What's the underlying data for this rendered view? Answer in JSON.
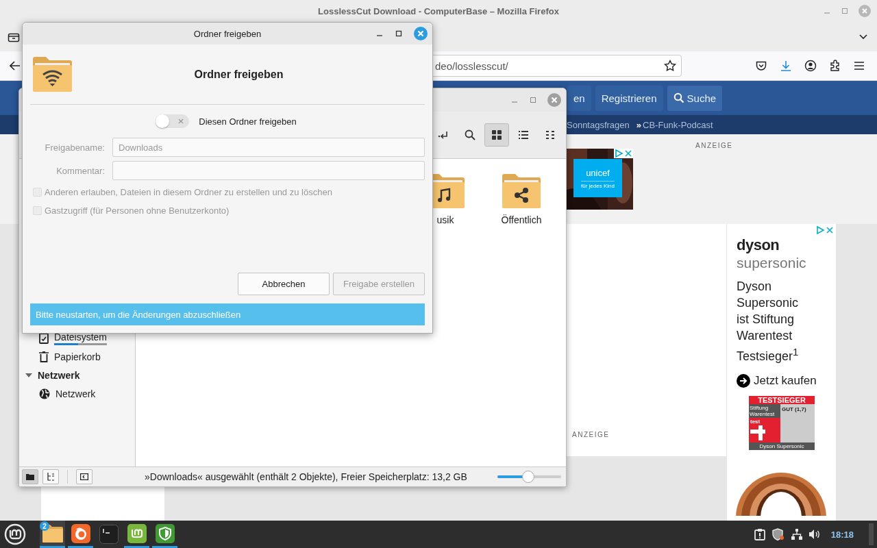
{
  "browser": {
    "title": "LosslessCut Download - ComputerBase – Mozilla Firefox",
    "url": "deo/losslesscut/"
  },
  "site": {
    "nav": [
      {
        "label": "en",
        "kind": "plain"
      },
      {
        "label": "Registrieren",
        "kind": "plain"
      },
      {
        "label": "Suche",
        "kind": "search"
      }
    ],
    "subnav": [
      {
        "label": "Sonntagsfragen",
        "marker_shown": false
      },
      {
        "label": "CB-Funk-Podcast",
        "marker": "»",
        "marker_shown": true
      }
    ],
    "ad_labels": [
      "ANZEIGE",
      "ANZEIGE"
    ]
  },
  "unicef_ad": {
    "logo": "unicef",
    "tagline": "für jedes Kind"
  },
  "dyson_ad": {
    "brand": "dyson",
    "product": "supersonic",
    "headline": "Dyson Supersonic ist Stiftung Warentest Testsieger$^{1}$",
    "cta": "Jetzt kaufen",
    "badge": {
      "title": "TESTSIEGER",
      "org": "Stiftung Warentest",
      "logo": "test",
      "grade": "GUT (1,7)",
      "footer": "Dyson Supersonic"
    }
  },
  "file_manager": {
    "toolbar": [
      {
        "kind": "return",
        "selected": false
      },
      {
        "kind": "search",
        "selected": false
      },
      {
        "kind": "grid",
        "selected": true
      },
      {
        "kind": "list",
        "selected": false
      },
      {
        "kind": "compact",
        "selected": false
      }
    ],
    "files": [
      {
        "name": "usik",
        "kind": "music"
      },
      {
        "name": "Öffentlich",
        "kind": "share"
      }
    ],
    "sidebar": {
      "items": [
        {
          "label": "Dateisystem",
          "kind": "drive",
          "level": 0.45
        },
        {
          "label": "Papierkorb",
          "kind": "trash"
        }
      ],
      "sections": [
        {
          "title": "Netzwerk",
          "expanded": true,
          "items": [
            {
              "label": "Netzwerk",
              "kind": "network"
            }
          ]
        }
      ]
    },
    "status_buttons": [
      {
        "kind": "places",
        "selected": true
      },
      {
        "kind": "tree",
        "selected": false
      },
      {
        "kind": "sidebar",
        "selected": false
      }
    ],
    "status": "»Downloads« ausgewählt (enthält 2 Objekte), Freier Speicherplatz: 13,2 GB",
    "zoom": {
      "level": 0.48
    }
  },
  "dialog": {
    "title": "Ordner freigeben",
    "heading": "Ordner freigeben",
    "share_toggle": {
      "label": "Diesen Ordner freigeben",
      "on": false
    },
    "fields": [
      {
        "label": "Freigabename:",
        "value": "Downloads",
        "disabled": true
      },
      {
        "label": "Kommentar:",
        "disabled": true
      }
    ],
    "checkboxes": [
      {
        "label": "Anderen erlauben, Dateien in diesem Ordner zu erstellen und zu löschen",
        "checked": false,
        "disabled": true
      },
      {
        "label": "Gastzugriff (für Personen ohne Benutzerkonto)",
        "checked": false,
        "disabled": true
      }
    ],
    "buttons": [
      {
        "label": "Abbrechen",
        "disabled": false
      },
      {
        "label": "Freigabe erstellen",
        "disabled": true
      }
    ],
    "info": "Bitte neustarten, um die Änderungen abzuschließen"
  },
  "taskbar": {
    "apps": [
      {
        "kind": "files",
        "badge": "2",
        "active": true,
        "running": true
      },
      {
        "kind": "firefox",
        "active": false,
        "running": true
      },
      {
        "kind": "terminal",
        "active": false,
        "running": false
      },
      {
        "kind": "update",
        "active": false,
        "running": true
      },
      {
        "kind": "shield",
        "active": false,
        "running": true
      }
    ],
    "tray": [
      {
        "kind": "clipboard"
      },
      {
        "kind": "shield"
      },
      {
        "kind": "network"
      },
      {
        "kind": "volume"
      }
    ],
    "clock": "18:18"
  }
}
